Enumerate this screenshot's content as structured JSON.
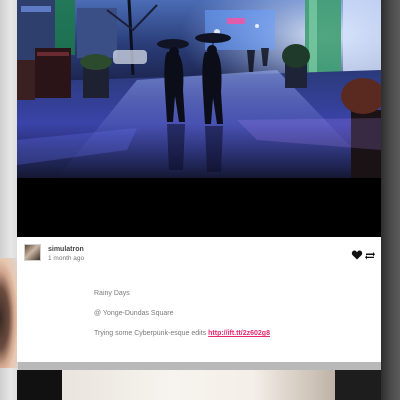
{
  "post": {
    "author": "simulatron",
    "timestamp": "1 month ago",
    "caption": {
      "title": "Rainy Days",
      "location": "@ Yonge-Dundas Square",
      "text": "Trying some Cyberpunk-esque edits",
      "link_text": "http://ift.tt/2z602g8"
    },
    "actions": {
      "like_icon": "heart-icon",
      "reblog_icon": "reblog-icon"
    }
  },
  "colors": {
    "link": "#e8286b",
    "caption_text": "#7a7a7a"
  }
}
